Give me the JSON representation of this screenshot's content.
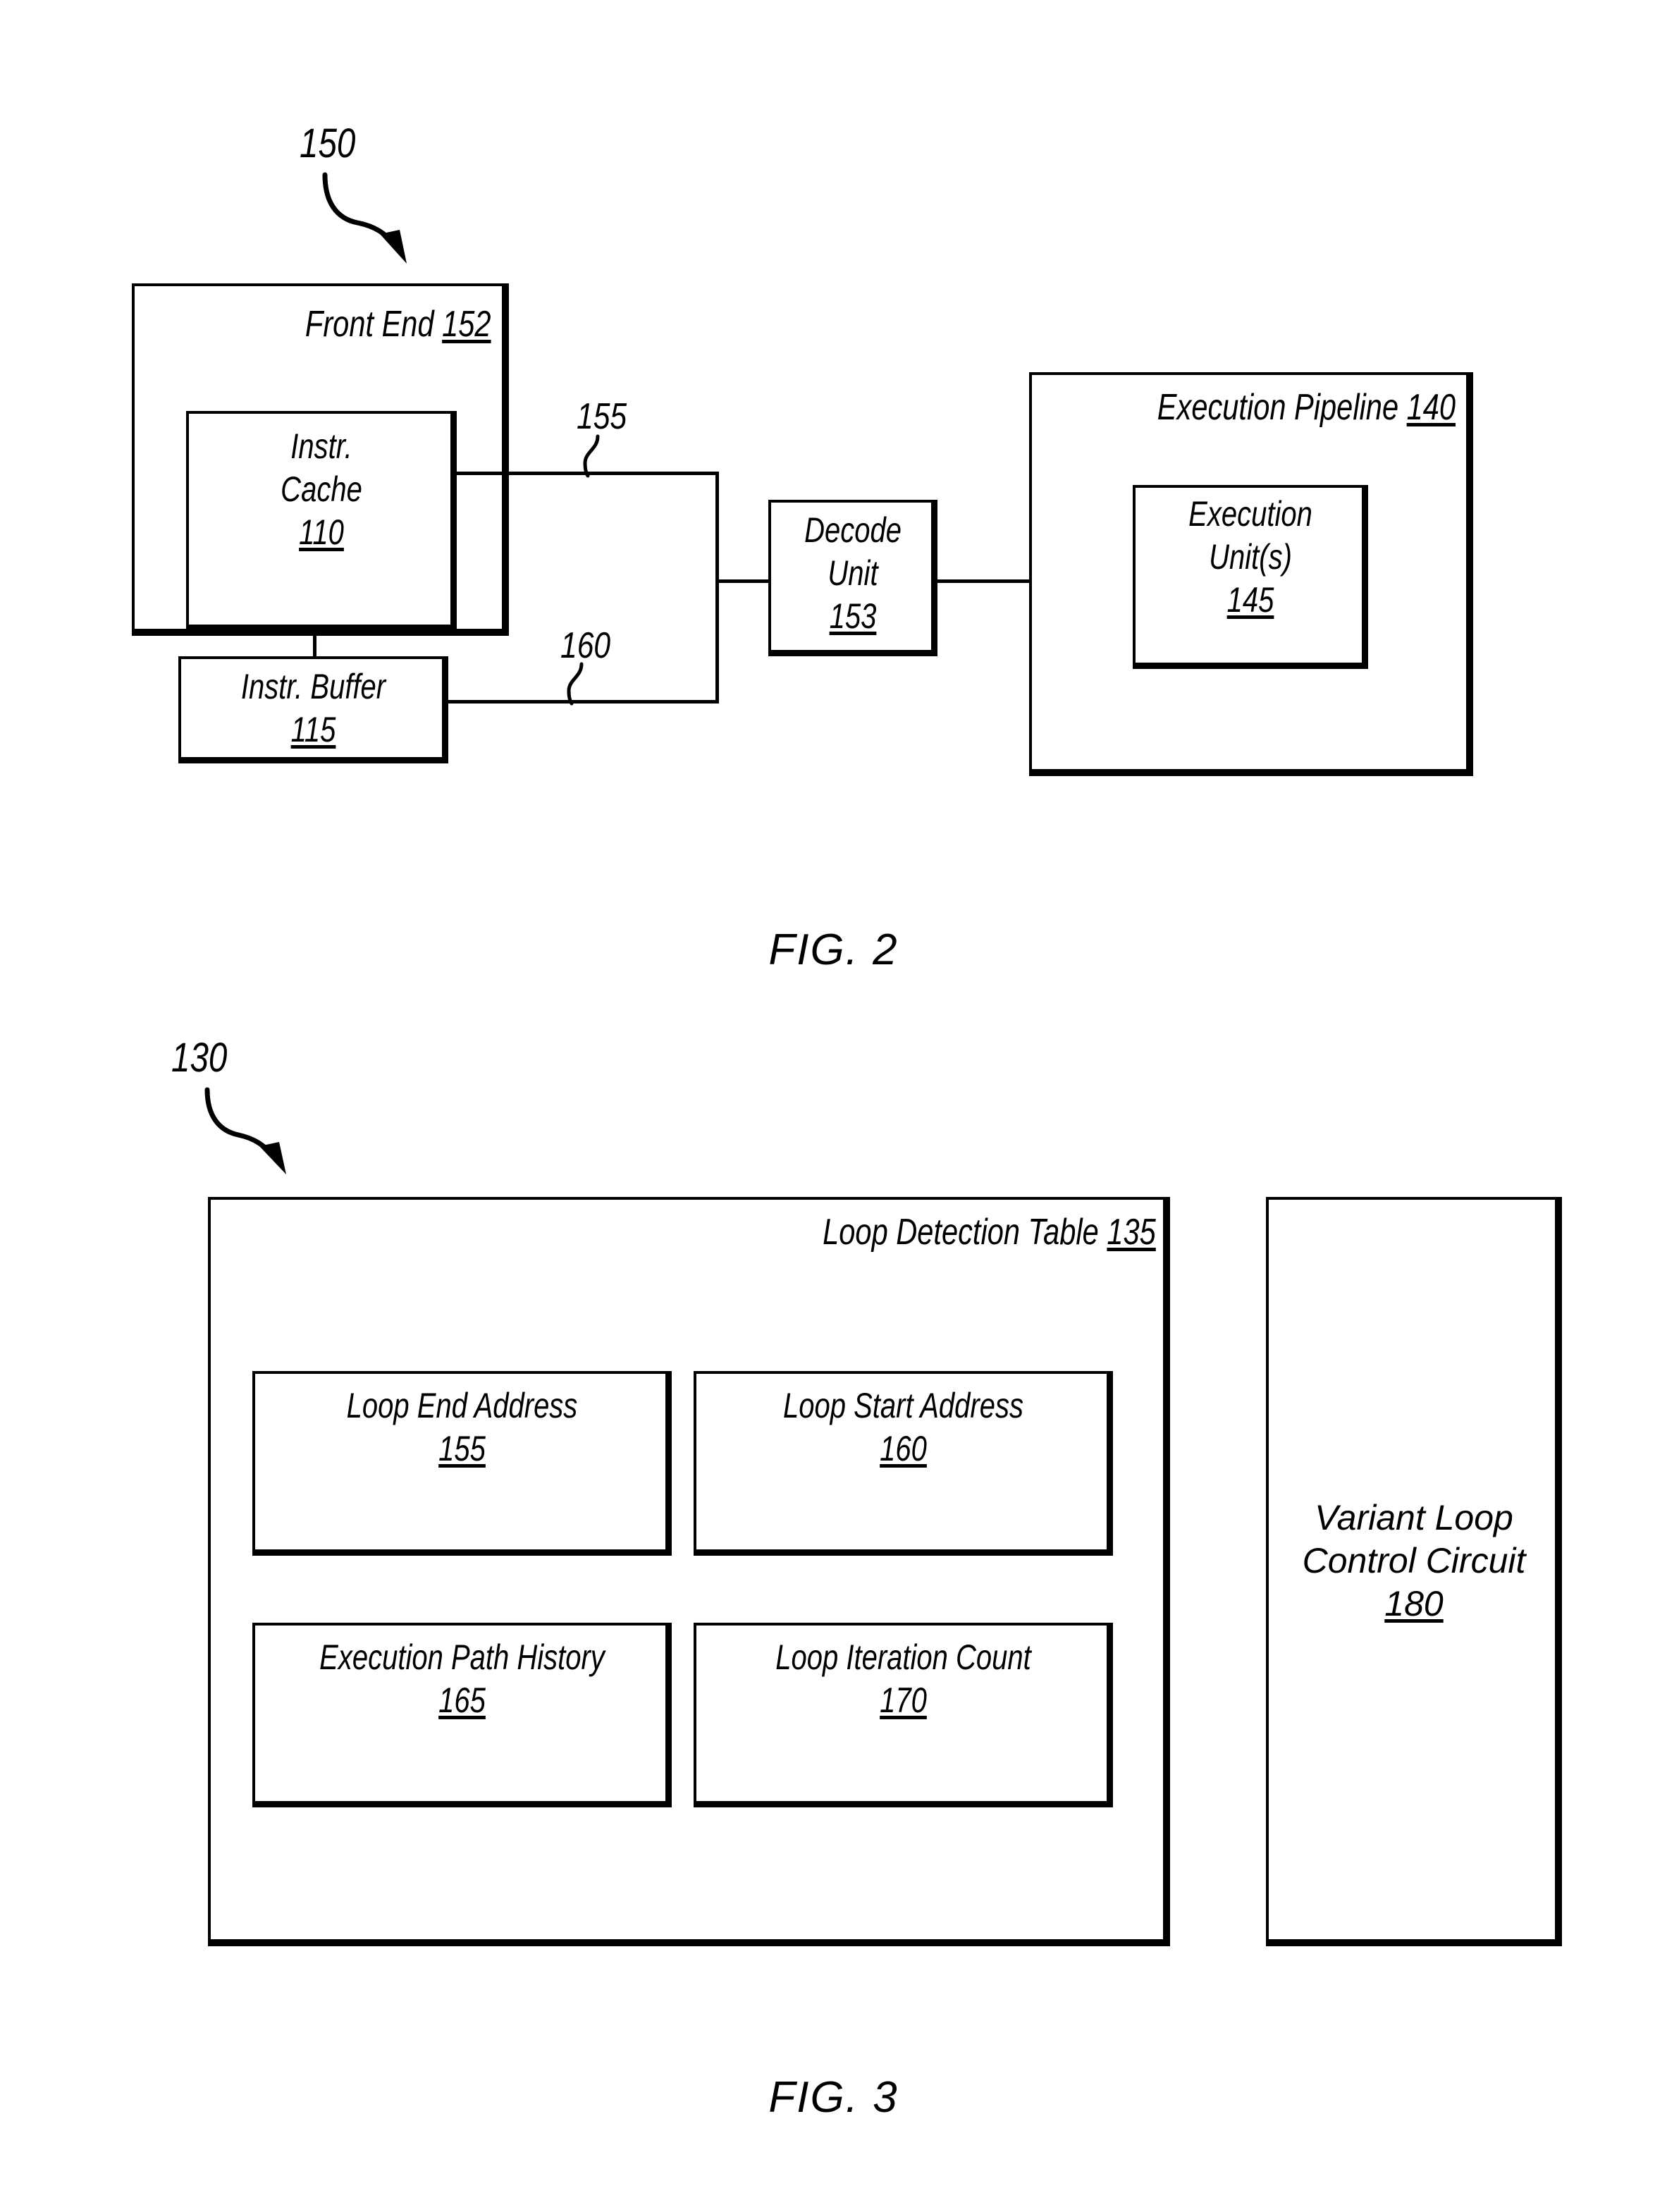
{
  "figure2": {
    "lead_ref": "150",
    "caption": "FIG. 2",
    "front_end": {
      "title": "Front End",
      "ref": "152"
    },
    "instr_cache": {
      "line1": "Instr.",
      "line2": "Cache",
      "ref": "110"
    },
    "instr_buffer": {
      "line1": "Instr. Buffer",
      "ref": "115"
    },
    "decode_unit": {
      "line1": "Decode",
      "line2": "Unit",
      "ref": "153"
    },
    "execution_pipeline": {
      "title": "Execution Pipeline",
      "ref": "140"
    },
    "execution_units": {
      "line1": "Execution",
      "line2": "Unit(s)",
      "ref": "145"
    },
    "signal_cache_out": "155",
    "signal_buffer_out": "160"
  },
  "figure3": {
    "lead_ref": "130",
    "caption": "FIG. 3",
    "loop_detection_table": {
      "title": "Loop Detection Table",
      "ref": "135"
    },
    "fields": [
      {
        "label": "Loop End Address",
        "ref": "155"
      },
      {
        "label": "Loop Start Address",
        "ref": "160"
      },
      {
        "label": "Execution Path History",
        "ref": "165"
      },
      {
        "label": "Loop Iteration Count",
        "ref": "170"
      }
    ],
    "variant_loop_control_circuit": {
      "line1": "Variant Loop",
      "line2": "Control Circuit",
      "ref": "180"
    }
  },
  "colors": {
    "ink": "#000000",
    "paper": "#ffffff"
  }
}
